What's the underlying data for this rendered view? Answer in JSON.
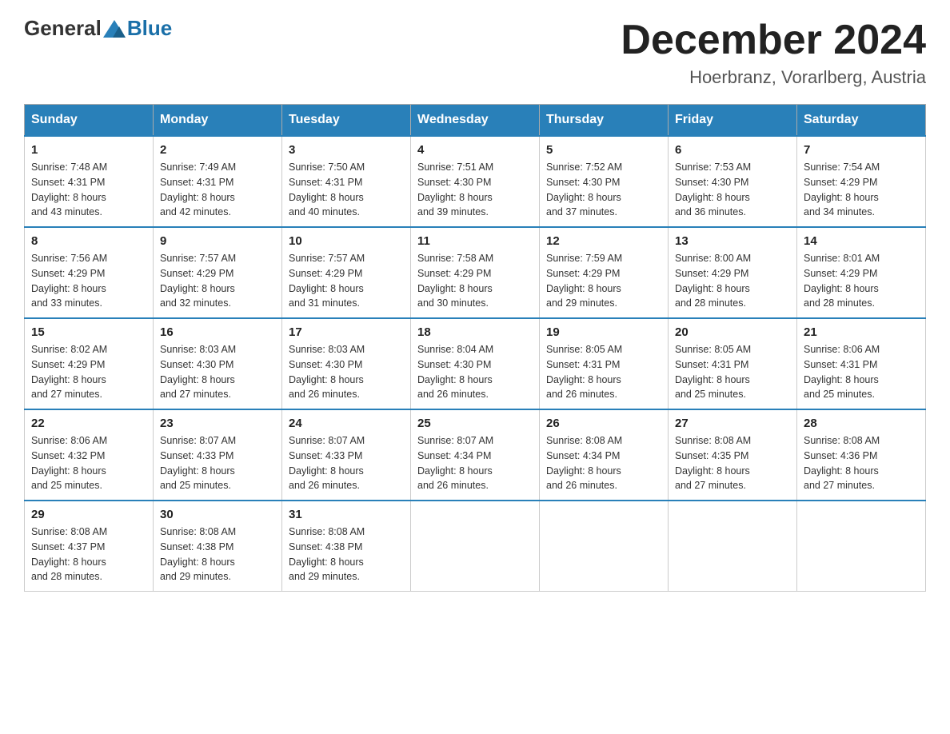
{
  "header": {
    "title": "December 2024",
    "subtitle": "Hoerbranz, Vorarlberg, Austria",
    "logo_general": "General",
    "logo_blue": "Blue"
  },
  "days_of_week": [
    "Sunday",
    "Monday",
    "Tuesday",
    "Wednesday",
    "Thursday",
    "Friday",
    "Saturday"
  ],
  "weeks": [
    [
      {
        "day": "1",
        "sunrise": "7:48 AM",
        "sunset": "4:31 PM",
        "daylight": "8 hours and 43 minutes."
      },
      {
        "day": "2",
        "sunrise": "7:49 AM",
        "sunset": "4:31 PM",
        "daylight": "8 hours and 42 minutes."
      },
      {
        "day": "3",
        "sunrise": "7:50 AM",
        "sunset": "4:31 PM",
        "daylight": "8 hours and 40 minutes."
      },
      {
        "day": "4",
        "sunrise": "7:51 AM",
        "sunset": "4:30 PM",
        "daylight": "8 hours and 39 minutes."
      },
      {
        "day": "5",
        "sunrise": "7:52 AM",
        "sunset": "4:30 PM",
        "daylight": "8 hours and 37 minutes."
      },
      {
        "day": "6",
        "sunrise": "7:53 AM",
        "sunset": "4:30 PM",
        "daylight": "8 hours and 36 minutes."
      },
      {
        "day": "7",
        "sunrise": "7:54 AM",
        "sunset": "4:29 PM",
        "daylight": "8 hours and 34 minutes."
      }
    ],
    [
      {
        "day": "8",
        "sunrise": "7:56 AM",
        "sunset": "4:29 PM",
        "daylight": "8 hours and 33 minutes."
      },
      {
        "day": "9",
        "sunrise": "7:57 AM",
        "sunset": "4:29 PM",
        "daylight": "8 hours and 32 minutes."
      },
      {
        "day": "10",
        "sunrise": "7:57 AM",
        "sunset": "4:29 PM",
        "daylight": "8 hours and 31 minutes."
      },
      {
        "day": "11",
        "sunrise": "7:58 AM",
        "sunset": "4:29 PM",
        "daylight": "8 hours and 30 minutes."
      },
      {
        "day": "12",
        "sunrise": "7:59 AM",
        "sunset": "4:29 PM",
        "daylight": "8 hours and 29 minutes."
      },
      {
        "day": "13",
        "sunrise": "8:00 AM",
        "sunset": "4:29 PM",
        "daylight": "8 hours and 28 minutes."
      },
      {
        "day": "14",
        "sunrise": "8:01 AM",
        "sunset": "4:29 PM",
        "daylight": "8 hours and 28 minutes."
      }
    ],
    [
      {
        "day": "15",
        "sunrise": "8:02 AM",
        "sunset": "4:29 PM",
        "daylight": "8 hours and 27 minutes."
      },
      {
        "day": "16",
        "sunrise": "8:03 AM",
        "sunset": "4:30 PM",
        "daylight": "8 hours and 27 minutes."
      },
      {
        "day": "17",
        "sunrise": "8:03 AM",
        "sunset": "4:30 PM",
        "daylight": "8 hours and 26 minutes."
      },
      {
        "day": "18",
        "sunrise": "8:04 AM",
        "sunset": "4:30 PM",
        "daylight": "8 hours and 26 minutes."
      },
      {
        "day": "19",
        "sunrise": "8:05 AM",
        "sunset": "4:31 PM",
        "daylight": "8 hours and 26 minutes."
      },
      {
        "day": "20",
        "sunrise": "8:05 AM",
        "sunset": "4:31 PM",
        "daylight": "8 hours and 25 minutes."
      },
      {
        "day": "21",
        "sunrise": "8:06 AM",
        "sunset": "4:31 PM",
        "daylight": "8 hours and 25 minutes."
      }
    ],
    [
      {
        "day": "22",
        "sunrise": "8:06 AM",
        "sunset": "4:32 PM",
        "daylight": "8 hours and 25 minutes."
      },
      {
        "day": "23",
        "sunrise": "8:07 AM",
        "sunset": "4:33 PM",
        "daylight": "8 hours and 25 minutes."
      },
      {
        "day": "24",
        "sunrise": "8:07 AM",
        "sunset": "4:33 PM",
        "daylight": "8 hours and 26 minutes."
      },
      {
        "day": "25",
        "sunrise": "8:07 AM",
        "sunset": "4:34 PM",
        "daylight": "8 hours and 26 minutes."
      },
      {
        "day": "26",
        "sunrise": "8:08 AM",
        "sunset": "4:34 PM",
        "daylight": "8 hours and 26 minutes."
      },
      {
        "day": "27",
        "sunrise": "8:08 AM",
        "sunset": "4:35 PM",
        "daylight": "8 hours and 27 minutes."
      },
      {
        "day": "28",
        "sunrise": "8:08 AM",
        "sunset": "4:36 PM",
        "daylight": "8 hours and 27 minutes."
      }
    ],
    [
      {
        "day": "29",
        "sunrise": "8:08 AM",
        "sunset": "4:37 PM",
        "daylight": "8 hours and 28 minutes."
      },
      {
        "day": "30",
        "sunrise": "8:08 AM",
        "sunset": "4:38 PM",
        "daylight": "8 hours and 29 minutes."
      },
      {
        "day": "31",
        "sunrise": "8:08 AM",
        "sunset": "4:38 PM",
        "daylight": "8 hours and 29 minutes."
      },
      null,
      null,
      null,
      null
    ]
  ],
  "labels": {
    "sunrise": "Sunrise:",
    "sunset": "Sunset:",
    "daylight": "Daylight:"
  }
}
